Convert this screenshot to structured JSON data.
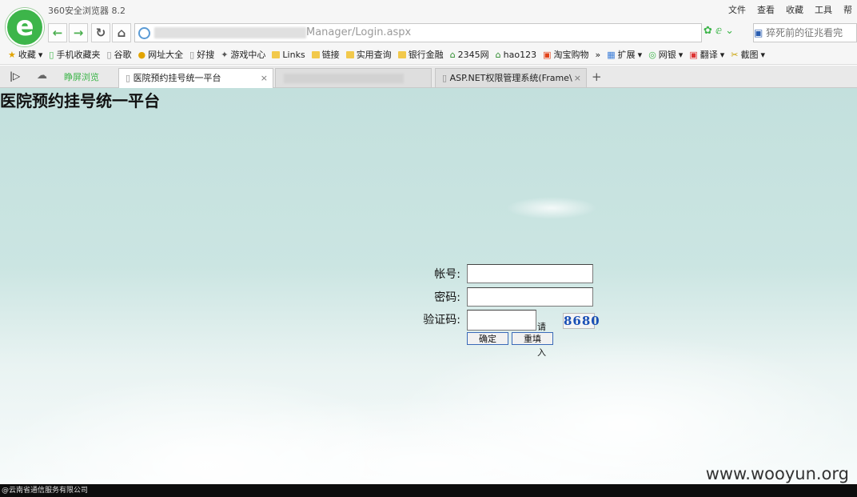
{
  "browser": {
    "title": "360安全浏览器 8.2",
    "menu": [
      "文件",
      "查看",
      "收藏",
      "工具",
      "帮"
    ],
    "address": {
      "url_visible": "Manager/Login.aspx"
    },
    "search_text": "猝死前的征兆看完",
    "bookmarks": [
      "收藏",
      "手机收藏夹",
      "谷歌",
      "网址大全",
      "好搜",
      "游戏中心",
      "Links",
      "链接",
      "实用查询",
      "银行金融",
      "2345网",
      "hao123",
      "淘宝购物",
      "扩展",
      "网银",
      "翻译",
      "截图"
    ],
    "tabs": {
      "side_label": "睁屏浏览",
      "active": "医院预约挂号统一平台",
      "third": "ASP.NET权限管理系统(Frame\\"
    }
  },
  "page": {
    "title": "医院预约挂号统一平台",
    "form": {
      "account_label": "帐号:",
      "password_label": "密码:",
      "captcha_label": "验证码:",
      "captcha_hint": "请输入",
      "captcha_code": "8680",
      "confirm_button": "确定",
      "reset_button": "重填"
    },
    "watermark": "www.wooyun.org",
    "footer": "@云南省通信服务有限公司"
  },
  "colors": {
    "accent": "#3db54a",
    "button_border": "#3a6ab8",
    "footer_bg": "#0d0d0d"
  }
}
